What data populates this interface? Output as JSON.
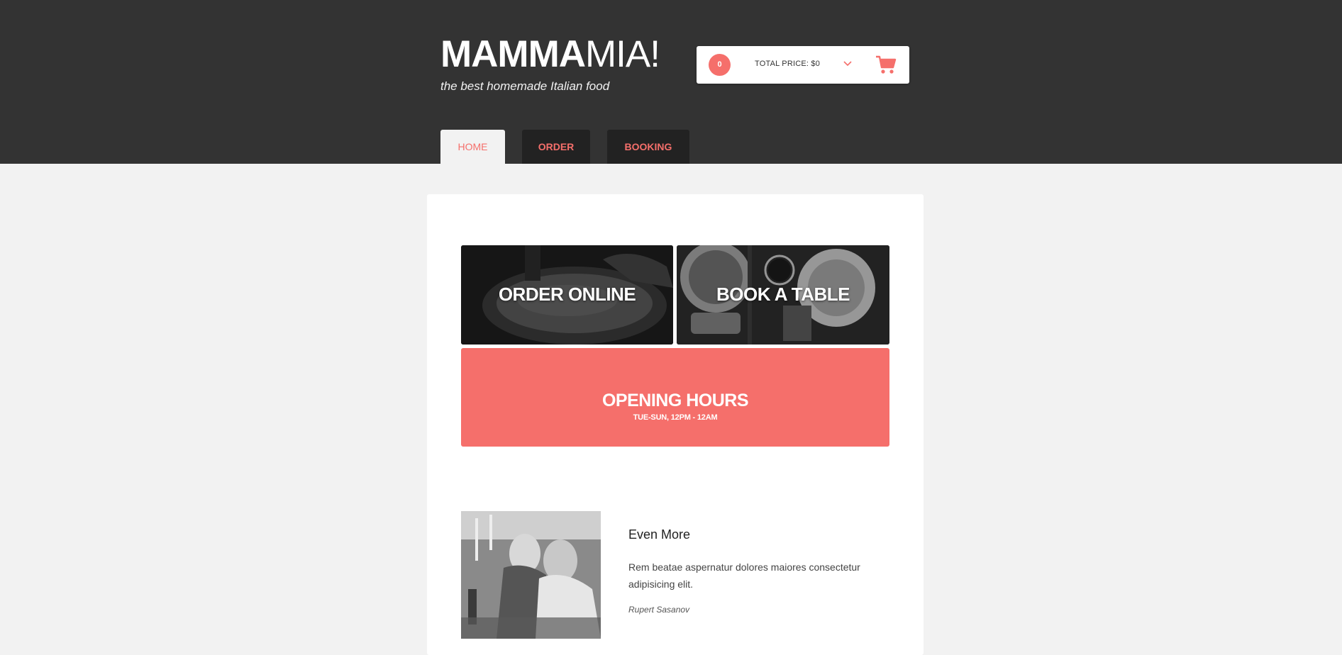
{
  "brand": {
    "logo_bold": "MAMMA",
    "logo_light": "MIA!",
    "tagline": "the best homemade Italian food"
  },
  "cart": {
    "count": "0",
    "total_label": "TOTAL PRICE: $0",
    "icon": "cart-icon",
    "accent": "#f56f6b"
  },
  "nav": {
    "tabs": [
      {
        "label": "HOME",
        "active": true
      },
      {
        "label": "ORDER",
        "active": false
      },
      {
        "label": "BOOKING",
        "active": false
      }
    ]
  },
  "tiles": {
    "order": "ORDER ONLINE",
    "book": "BOOK A TABLE",
    "hours_title": "OPENING HOURS",
    "hours_text": "TUE-SUN, 12PM - 12AM"
  },
  "testimonial": {
    "title": "Even More",
    "text": "Rem beatae aspernatur dolores maiores consectetur adipisicing elit.",
    "author": "Rupert Sasanov"
  },
  "colors": {
    "header_bg": "#333333",
    "accent": "#f56f6b",
    "page_bg": "#f2f2f2"
  }
}
